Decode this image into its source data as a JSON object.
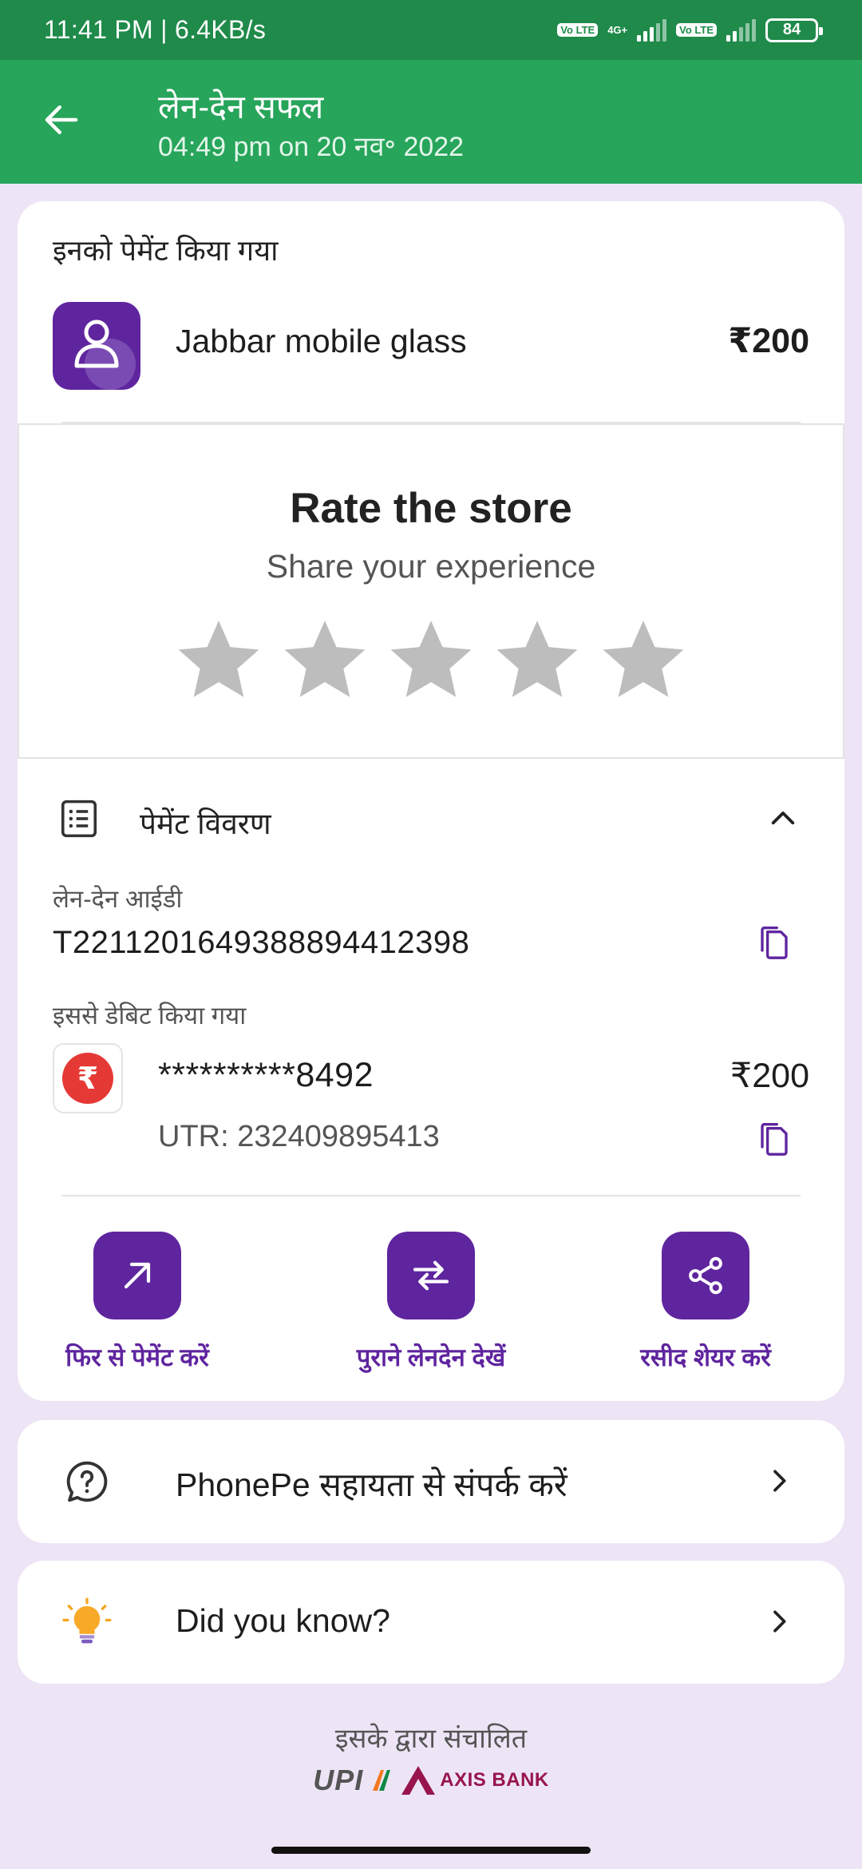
{
  "status_bar": {
    "time_speed": "11:41 PM | 6.4KB/s",
    "volte1": "Vo LTE",
    "network": "4G+",
    "volte2": "Vo LTE",
    "battery": "84"
  },
  "header": {
    "title": "लेन-देन सफल",
    "subtitle": "04:49 pm on 20 नव॰ 2022"
  },
  "payment": {
    "paid_to_label": "इनको पेमेंट किया गया",
    "payee_name": "Jabbar mobile glass",
    "amount": "₹200"
  },
  "rating": {
    "title": "Rate the store",
    "subtitle": "Share your experience",
    "max_stars": 5,
    "selected_stars": 0,
    "star_color": "#bdbdbd"
  },
  "details": {
    "title": "पेमेंट विवरण",
    "txn_id_label": "लेन-देन आईडी",
    "txn_id": "T2211201649388894412398",
    "debited_from_label": "इससे डेबिट किया गया",
    "account_number": "**********8492",
    "debit_amount": "₹200",
    "utr": "UTR: 232409895413"
  },
  "actions": [
    {
      "label": "फिर से पेमेंट करें",
      "icon": "arrow-up-right-icon"
    },
    {
      "label": "पुराने लेनदेन देखें",
      "icon": "swap-arrows-icon"
    },
    {
      "label": "रसीद शेयर करें",
      "icon": "share-icon"
    }
  ],
  "support": {
    "label": "PhonePe सहायता से संपर्क करें",
    "icon": "help-icon"
  },
  "did_you_know": {
    "label": "Did you know?",
    "icon": "bulb-icon"
  },
  "footer": {
    "powered_by": "इसके द्वारा संचालित",
    "upi_logo": "UPI",
    "bank_logo": "AXIS BANK"
  },
  "colors": {
    "status_bar": "#1f8a4a",
    "header": "#27a55b",
    "brand_purple": "#5f259f",
    "page_background": "#ede5f6",
    "bank_red": "#e53935"
  }
}
